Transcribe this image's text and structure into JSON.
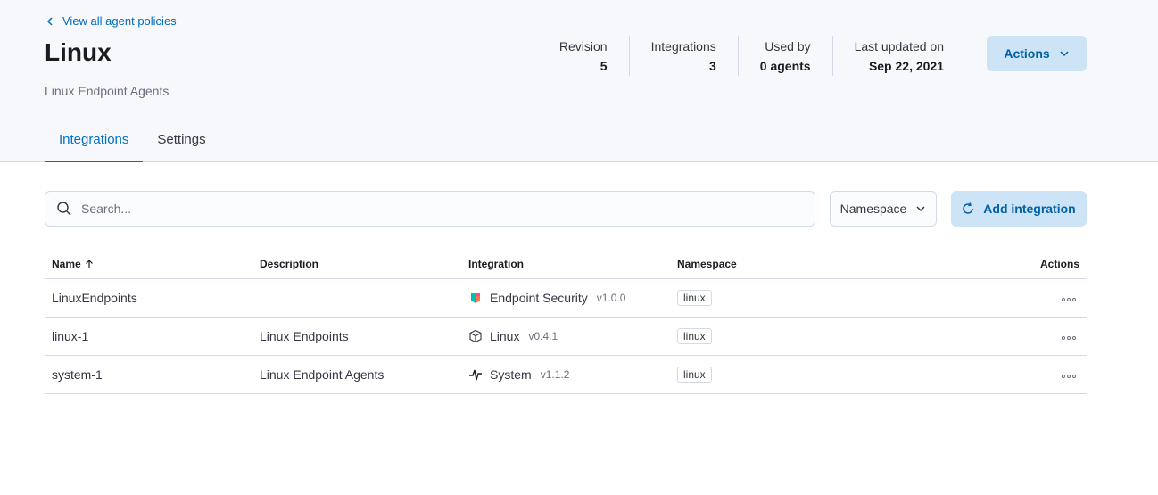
{
  "back_link": "View all agent policies",
  "policy": {
    "title": "Linux",
    "subtitle": "Linux Endpoint Agents"
  },
  "stats": [
    {
      "label": "Revision",
      "value": "5"
    },
    {
      "label": "Integrations",
      "value": "3"
    },
    {
      "label": "Used by",
      "value": "0 agents"
    },
    {
      "label": "Last updated on",
      "value": "Sep 22, 2021"
    }
  ],
  "actions_button": "Actions",
  "tabs": [
    {
      "label": "Integrations",
      "active": true
    },
    {
      "label": "Settings",
      "active": false
    }
  ],
  "search": {
    "placeholder": "Search..."
  },
  "namespace_filter": "Namespace",
  "add_integration": "Add integration",
  "table": {
    "headers": {
      "name": "Name",
      "description": "Description",
      "integration": "Integration",
      "namespace": "Namespace",
      "actions": "Actions"
    },
    "rows": [
      {
        "name": "LinuxEndpoints",
        "description": "",
        "integration": "Endpoint Security",
        "version": "v1.0.0",
        "icon": "endpoint-security-icon",
        "namespace": "linux"
      },
      {
        "name": "linux-1",
        "description": "Linux Endpoints",
        "integration": "Linux",
        "version": "v0.4.1",
        "icon": "cube-icon",
        "namespace": "linux"
      },
      {
        "name": "system-1",
        "description": "Linux Endpoint Agents",
        "integration": "System",
        "version": "v1.1.2",
        "icon": "pulse-icon",
        "namespace": "linux"
      }
    ]
  },
  "colors": {
    "accent": "#0071c2",
    "button_bg": "#cce4f5",
    "header_bg": "#f7f8fc"
  }
}
